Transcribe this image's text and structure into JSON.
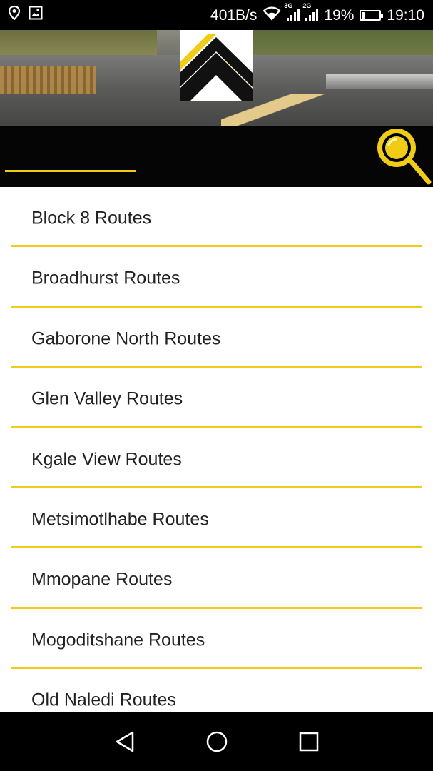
{
  "status_bar": {
    "net_speed": "401B/s",
    "sim1_type": "3G",
    "sim2_type": "2G",
    "battery_percent": "19%",
    "battery_level": 0.19,
    "time": "19:10"
  },
  "header": {
    "tab_label": ""
  },
  "routes": [
    {
      "label": "Block 8 Routes"
    },
    {
      "label": "Broadhurst Routes"
    },
    {
      "label": "Gaborone North Routes"
    },
    {
      "label": "Glen Valley Routes"
    },
    {
      "label": "Kgale View Routes"
    },
    {
      "label": "Metsimotlhabe Routes"
    },
    {
      "label": "Mmopane Routes"
    },
    {
      "label": "Mogoditshane Routes"
    },
    {
      "label": "Old Naledi Routes"
    }
  ],
  "colors": {
    "accent": "#f1cc17",
    "tab_bar": "#050505",
    "text": "#222222"
  },
  "icons": {
    "location": "location-pin-icon",
    "image": "image-icon",
    "wifi": "wifi-icon",
    "search": "search-icon",
    "back": "back-icon",
    "home": "home-icon",
    "recents": "recents-icon"
  }
}
